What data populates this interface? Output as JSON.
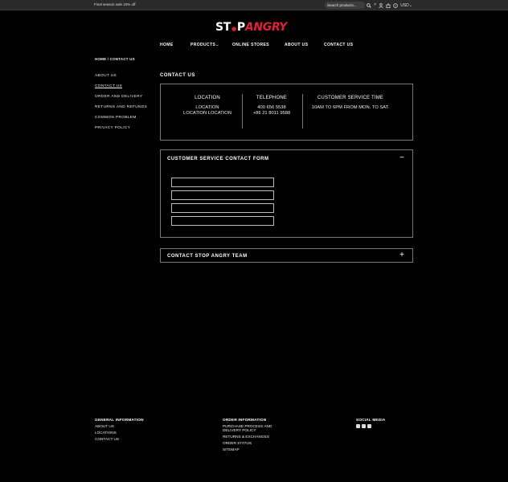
{
  "topbar": {
    "promo": "Final season sale 10% off",
    "search_placeholder": "Search products...",
    "icons": [
      "search-icon",
      "close-icon",
      "user-icon",
      "cart-icon",
      "help-icon"
    ],
    "currency": "USD"
  },
  "logo": {
    "part1": "ST",
    "part2": "P",
    "part3": "ANGRY"
  },
  "nav": {
    "items": [
      "HOME",
      "PRODUCTS",
      "ONLINE STORES",
      "ABOUT US",
      "CONTACT US"
    ]
  },
  "breadcrumb": "HOME / CONTACT US",
  "sidebar": {
    "items": [
      "ABOUT US",
      "CONTACT US",
      "ORDER AND DELIVERY",
      "RETURNS AND REFUNDS",
      "COMMON PROBLEM",
      "PRIVACY POLICY"
    ],
    "active_index": 1
  },
  "page_title": "CONTACT US",
  "info": {
    "location": {
      "heading": "LOCATION",
      "line1": "LOCATION",
      "line2": "LOCATION LOCATION"
    },
    "telephone": {
      "heading": "TELEPHONE",
      "line1": "400 656 5538",
      "line2": "+86 21 8011 9588"
    },
    "service": {
      "heading": "CUSTOMER SERVICE TIME",
      "line1": "10AM TO 6PM FROM MON. TO SAT."
    }
  },
  "contact_form": {
    "title": "CUSTOMER SERVICE CONTACT FORM",
    "toggle": "−",
    "fields": [
      {
        "value": ""
      },
      {
        "value": ""
      },
      {
        "value": ""
      },
      {
        "value": ""
      }
    ]
  },
  "team_panel": {
    "title": "CONTACT STOP ANGRY TEAM",
    "toggle": "+"
  },
  "footer": {
    "general": {
      "heading": "GENERAL INFORMATION",
      "links": [
        "ABOUT US",
        "LOCATIONS",
        "CONTACT US"
      ]
    },
    "order": {
      "heading": "ORDER INFORMATION",
      "links": [
        "PURCHASE PROCESS AND DELIVERY POLICY",
        "RETURNS & EXCHANGES",
        "ORDER STATUS",
        "SITEMAP"
      ]
    },
    "social": {
      "heading": "SOCIAL MEDIA",
      "icons": [
        "instagram-icon",
        "facebook-icon",
        "youtube-icon"
      ]
    }
  },
  "colors": {
    "background": "#000000",
    "topbar": "#2a2a2a",
    "brand_red": "#e0203a",
    "border": "#777777"
  }
}
